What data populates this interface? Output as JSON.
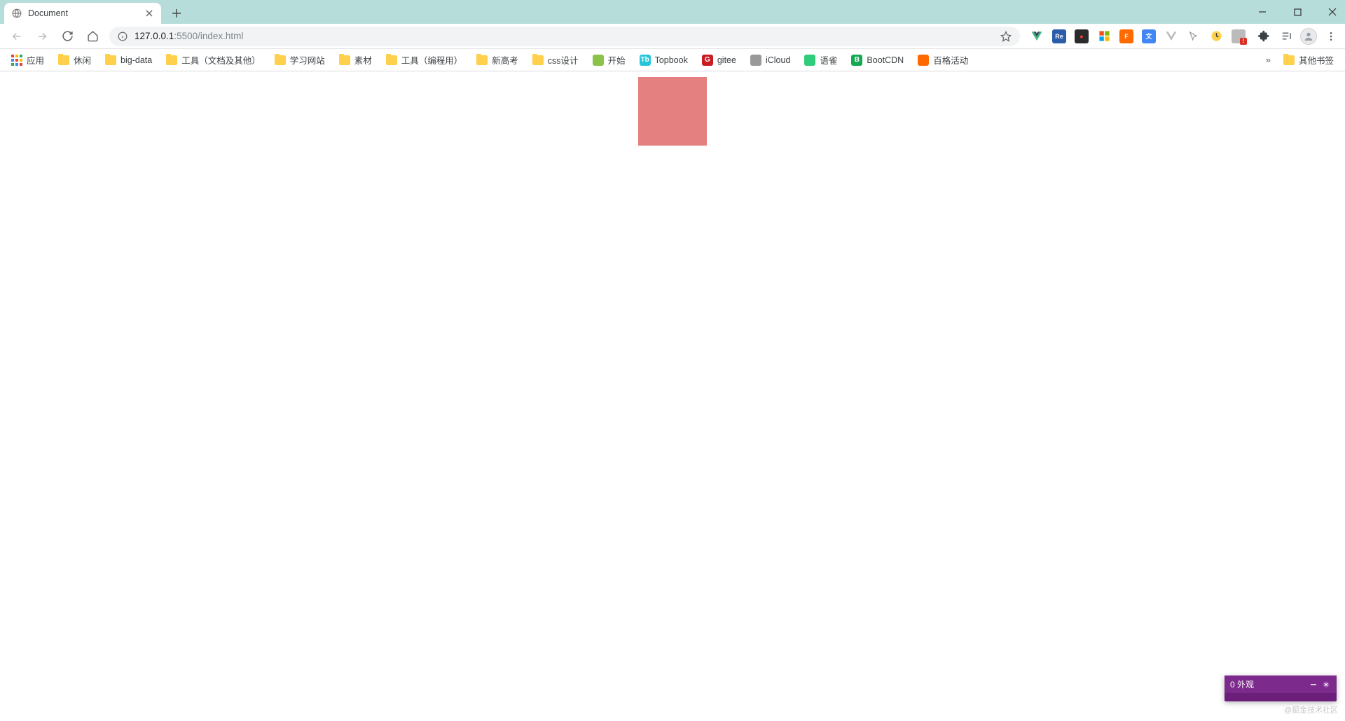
{
  "tab": {
    "title": "Document"
  },
  "url": {
    "host": "127.0.0.1",
    "port": ":5500",
    "path": "/index.html"
  },
  "bookmarks": {
    "apps_label": "应用",
    "items": [
      {
        "label": "休闲",
        "icon": "folder"
      },
      {
        "label": "big-data",
        "icon": "folder"
      },
      {
        "label": "工具（文档及其他）",
        "icon": "folder"
      },
      {
        "label": "学习网站",
        "icon": "folder"
      },
      {
        "label": "素材",
        "icon": "folder"
      },
      {
        "label": "工具（编程用）",
        "icon": "folder"
      },
      {
        "label": "新高考",
        "icon": "folder"
      },
      {
        "label": "css设计",
        "icon": "folder"
      },
      {
        "label": "开始",
        "icon": "fav",
        "bg": "#8bc34a"
      },
      {
        "label": "Topbook",
        "icon": "fav",
        "bg": "#26c6da",
        "txt": "Tb"
      },
      {
        "label": "gitee",
        "icon": "fav",
        "bg": "#c71d23",
        "txt": "G"
      },
      {
        "label": "iCloud",
        "icon": "fav",
        "bg": "#999",
        "txt": ""
      },
      {
        "label": "语雀",
        "icon": "fav",
        "bg": "#31cc79",
        "txt": ""
      },
      {
        "label": "BootCDN",
        "icon": "fav",
        "bg": "#13aa52",
        "txt": "B"
      },
      {
        "label": "百格活动",
        "icon": "fav",
        "bg": "#ff6a00",
        "txt": ""
      }
    ],
    "other_label": "其他书签"
  },
  "extensions": [
    {
      "name": "vue-ext",
      "bg": "transparent",
      "txt": "",
      "svg": "vue"
    },
    {
      "name": "react-ext",
      "bg": "#2a5caa",
      "txt": "Re"
    },
    {
      "name": "record-ext",
      "bg": "#2b2b2b",
      "txt": "●",
      "fg": "#ff3b30"
    },
    {
      "name": "ms-ext",
      "bg": "transparent",
      "txt": "",
      "svg": "ms"
    },
    {
      "name": "foxit-ext",
      "bg": "#ff6a00",
      "txt": "F"
    },
    {
      "name": "translate-ext",
      "bg": "#4285f4",
      "txt": "文"
    },
    {
      "name": "vue-gray-ext",
      "bg": "transparent",
      "txt": "",
      "svg": "vue-gray"
    },
    {
      "name": "cursor-ext",
      "bg": "transparent",
      "txt": "",
      "svg": "cursor"
    },
    {
      "name": "clock-ext",
      "bg": "transparent",
      "txt": "",
      "svg": "clock"
    },
    {
      "name": "badge-ext",
      "bg": "#bbb",
      "txt": "",
      "badge": "!"
    }
  ],
  "dev_panel": {
    "title": "0 外观"
  },
  "watermark": "@掘金技术社区",
  "colors": {
    "box": "#e58080"
  }
}
